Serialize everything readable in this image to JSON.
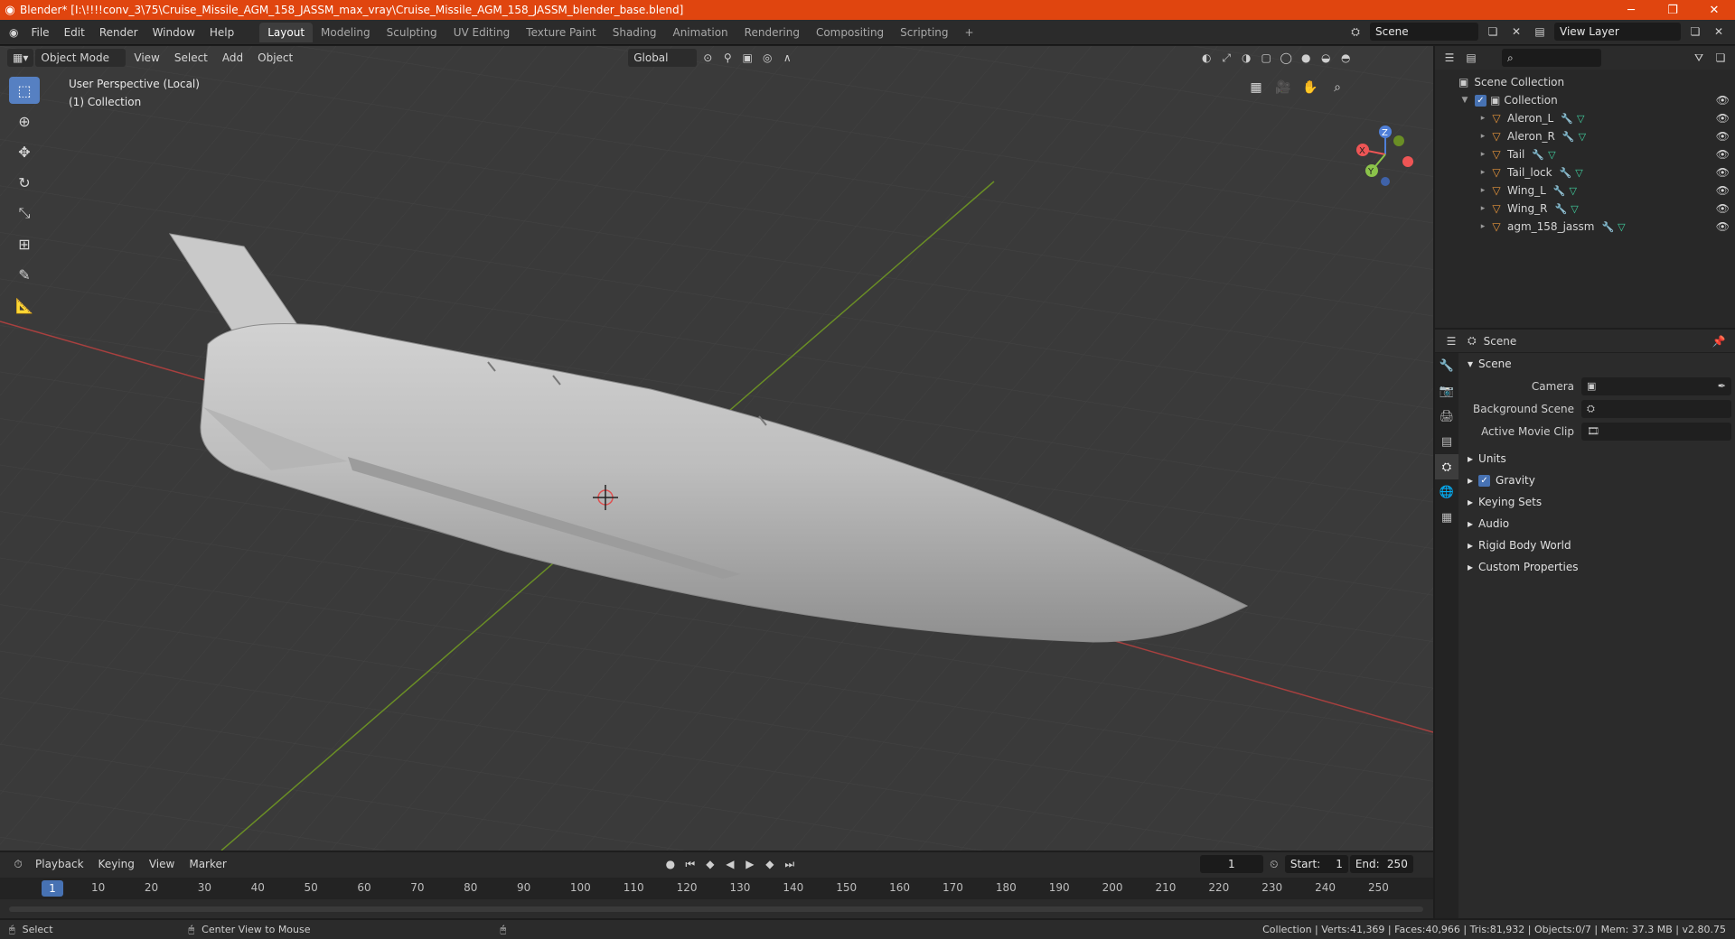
{
  "titlebar": {
    "title": "Blender* [I:\\!!!!conv_3\\75\\Cruise_Missile_AGM_158_JASSM_max_vray\\Cruise_Missile_AGM_158_JASSM_blender_base.blend]"
  },
  "menu": [
    "File",
    "Edit",
    "Render",
    "Window",
    "Help"
  ],
  "workspaces": [
    "Layout",
    "Modeling",
    "Sculpting",
    "UV Editing",
    "Texture Paint",
    "Shading",
    "Animation",
    "Rendering",
    "Compositing",
    "Scripting"
  ],
  "topright": {
    "scene": "Scene",
    "view_layer": "View Layer"
  },
  "viewport": {
    "mode": "Object Mode",
    "menus": [
      "View",
      "Select",
      "Add",
      "Object"
    ],
    "transform": "Global",
    "info_line1": "User Perspective (Local)",
    "info_line2": "(1) Collection"
  },
  "outliner": {
    "root": "Scene Collection",
    "collection": "Collection",
    "items": [
      "Aleron_L",
      "Aleron_R",
      "Tail",
      "Tail_lock",
      "Wing_L",
      "Wing_R",
      "agm_158_jassm"
    ]
  },
  "properties": {
    "context": "Scene",
    "panel": "Scene",
    "camera_label": "Camera",
    "bg_scene_label": "Background Scene",
    "movie_clip_label": "Active Movie Clip",
    "subpanels": [
      "Units",
      "Gravity",
      "Keying Sets",
      "Audio",
      "Rigid Body World",
      "Custom Properties"
    ]
  },
  "timeline": {
    "menus": [
      "Playback",
      "Keying",
      "View",
      "Marker"
    ],
    "current_frame": "1",
    "start_label": "Start:",
    "start": "1",
    "end_label": "End:",
    "end": "250",
    "ticks": [
      "1",
      "10",
      "20",
      "30",
      "40",
      "50",
      "60",
      "70",
      "80",
      "90",
      "100",
      "110",
      "120",
      "130",
      "140",
      "150",
      "160",
      "170",
      "180",
      "190",
      "200",
      "210",
      "220",
      "230",
      "240",
      "250"
    ]
  },
  "statusbar": {
    "select": "Select",
    "center": "Center View to Mouse",
    "stats": "Collection | Verts:41,369 | Faces:40,966 | Tris:81,932 | Objects:0/7 | Mem: 37.3 MB | v2.80.75"
  },
  "colors": {
    "accent": "#4772b3",
    "titlebar": "#e0450f",
    "object_icon": "#e8963b",
    "mesh_icon": "#41d1a0"
  }
}
